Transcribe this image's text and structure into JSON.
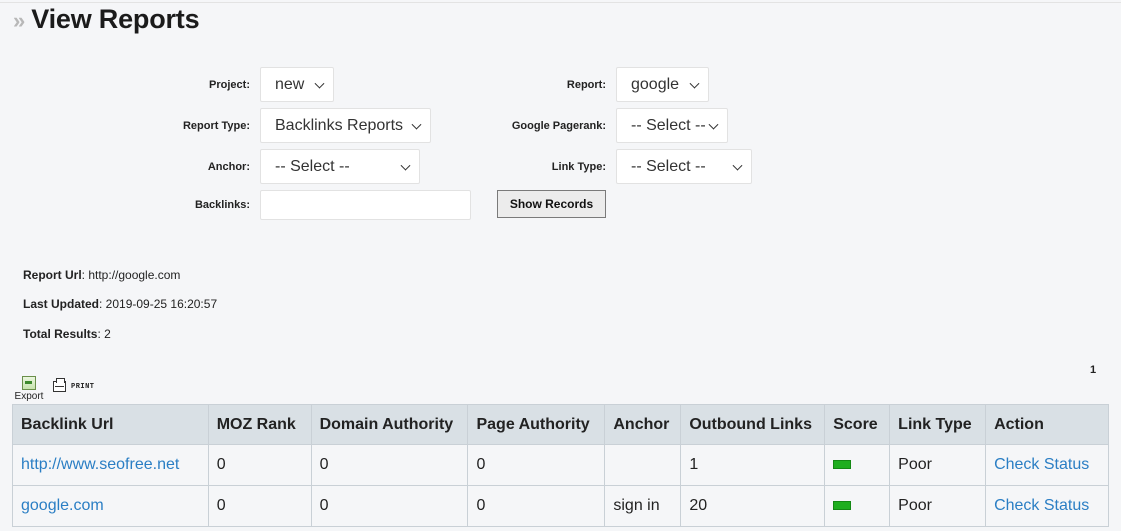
{
  "page": {
    "title": "View Reports"
  },
  "filters": {
    "project": {
      "label": "Project:",
      "value": "new"
    },
    "report": {
      "label": "Report:",
      "value": "google"
    },
    "report_type": {
      "label": "Report Type:",
      "value": "Backlinks Reports"
    },
    "google_pagerank": {
      "label": "Google Pagerank:",
      "value": "-- Select --"
    },
    "anchor": {
      "label": "Anchor:",
      "value": "-- Select --"
    },
    "link_type": {
      "label": "Link Type:",
      "value": "-- Select --"
    },
    "backlinks": {
      "label": "Backlinks:",
      "value": ""
    },
    "show_records": "Show Records"
  },
  "info": {
    "report_url_label": "Report Url",
    "report_url": ": http://google.com",
    "last_updated_label": "Last Updated",
    "last_updated": ": 2019-09-25 16:20:57",
    "total_results_label": "Total Results",
    "total_results": ": 2"
  },
  "pagination": {
    "current": "1"
  },
  "toolbar": {
    "export_label": "Export",
    "print_label": "PRINT"
  },
  "table": {
    "headers": [
      "Backlink Url",
      "MOZ Rank",
      "Domain Authority",
      "Page Authority",
      "Anchor",
      "Outbound Links",
      "Score",
      "Link Type",
      "Action"
    ],
    "rows": [
      {
        "url": "http://www.seofree.net",
        "moz": "0",
        "da": "0",
        "pa": "0",
        "anchor": "",
        "outbound": "1",
        "link_type": "Poor",
        "action": "Check Status"
      },
      {
        "url": "google.com",
        "moz": "0",
        "da": "0",
        "pa": "0",
        "anchor": "sign in",
        "outbound": "20",
        "link_type": "Poor",
        "action": "Check Status"
      }
    ]
  },
  "colors": {
    "link": "#2a7ec4",
    "score": "#1fae1f",
    "header_bg": "#d9e0e5"
  }
}
